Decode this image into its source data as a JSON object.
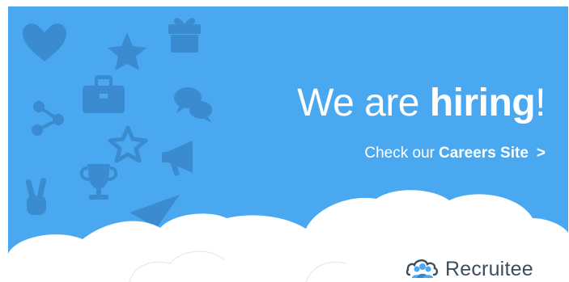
{
  "banner": {
    "headline_prefix": "We are ",
    "headline_bold": "hiring",
    "headline_suffix": "!",
    "sub_prefix": "Check our",
    "sub_bold": "Careers Site",
    "chevron": ">",
    "logo_text": "Recruitee",
    "colors": {
      "background": "#4aa8f0",
      "icon": "#3b8bd0",
      "cloud": "#ffffff",
      "logo_text": "#3e4d5c",
      "logo_mark": "#4aa8f0"
    },
    "icons": [
      "heart-icon",
      "star-icon",
      "gift-icon",
      "briefcase-icon",
      "share-icon",
      "chat-bubbles-icon",
      "star-outline-icon",
      "megaphone-icon",
      "trophy-icon",
      "peace-hand-icon",
      "paper-plane-icon"
    ]
  }
}
